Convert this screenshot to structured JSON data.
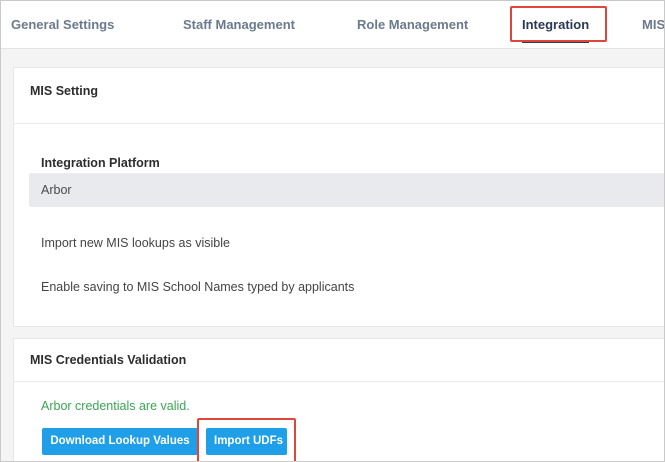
{
  "tabs": [
    {
      "label": "General Settings"
    },
    {
      "label": "Staff Management"
    },
    {
      "label": "Role Management"
    },
    {
      "label": "Integration"
    },
    {
      "label": "MIS"
    }
  ],
  "active_tab": "Integration",
  "mis_setting": {
    "title": "MIS Setting",
    "platform_label": "Integration Platform",
    "platform_value": "Arbor",
    "option_import_visible": "Import new MIS lookups as visible",
    "option_enable_saving": "Enable saving to MIS School Names typed by applicants"
  },
  "credentials": {
    "title": "MIS Credentials Validation",
    "status_text": "Arbor credentials are valid.",
    "status_color": "#3aa655",
    "download_button": "Download Lookup Values",
    "import_button": "Import UDFs",
    "button_color": "#1e9fe8"
  },
  "highlight_color": "#e0453a"
}
